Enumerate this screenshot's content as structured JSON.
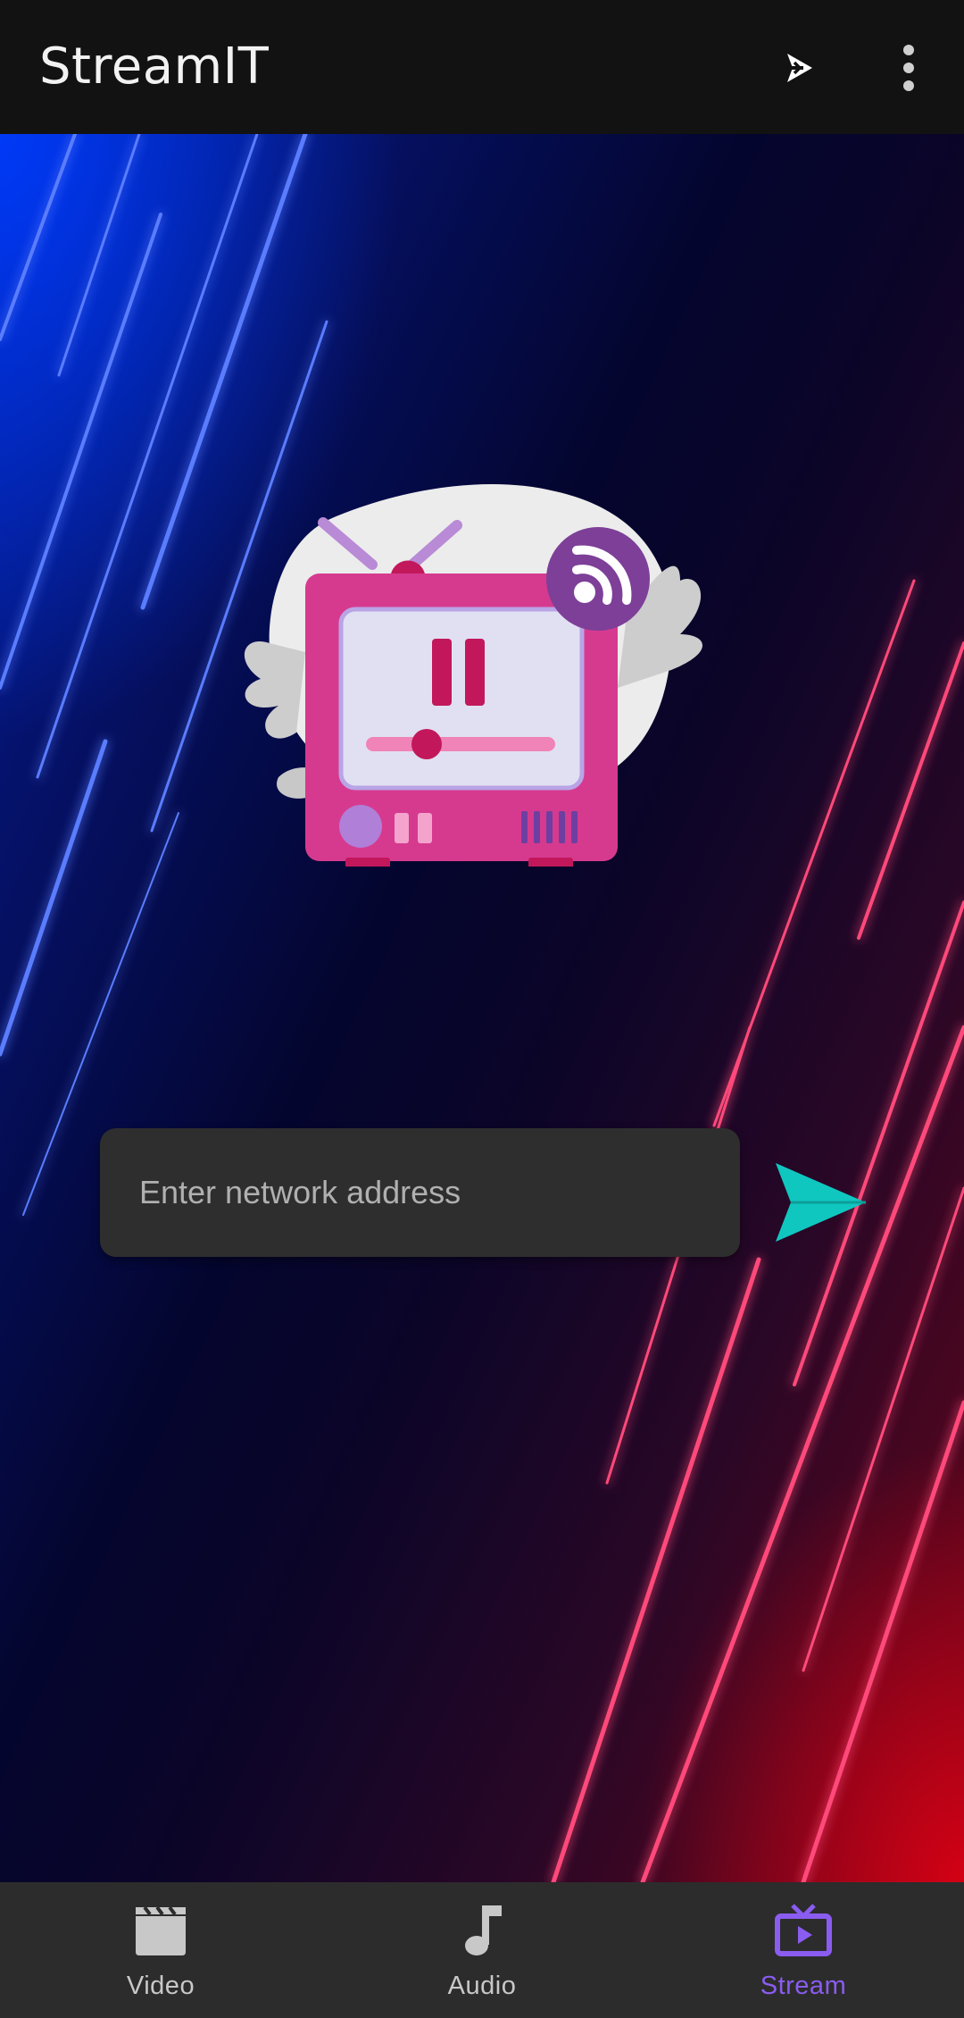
{
  "app": {
    "title": "StreamIT"
  },
  "toolbar": {
    "cast_icon": "cast-play-icon",
    "menu_icon": "more-vert-icon"
  },
  "stream": {
    "illustration": "retro-tv-streaming-illustration",
    "address_placeholder": "Enter network address",
    "address_value": "",
    "send_icon": "send-icon"
  },
  "colors": {
    "appbar": "#121212",
    "input_bg": "#2e2e2e",
    "send": "#10c7c0",
    "nav_bg": "#2c2c2c",
    "nav_inactive": "#c8c8c8",
    "nav_active": "#8a5cf0"
  },
  "bottom_nav": {
    "items": [
      {
        "label": "Video",
        "icon": "clapperboard-icon",
        "active": false
      },
      {
        "label": "Audio",
        "icon": "music-note-icon",
        "active": false
      },
      {
        "label": "Stream",
        "icon": "tv-play-icon",
        "active": true
      }
    ]
  }
}
